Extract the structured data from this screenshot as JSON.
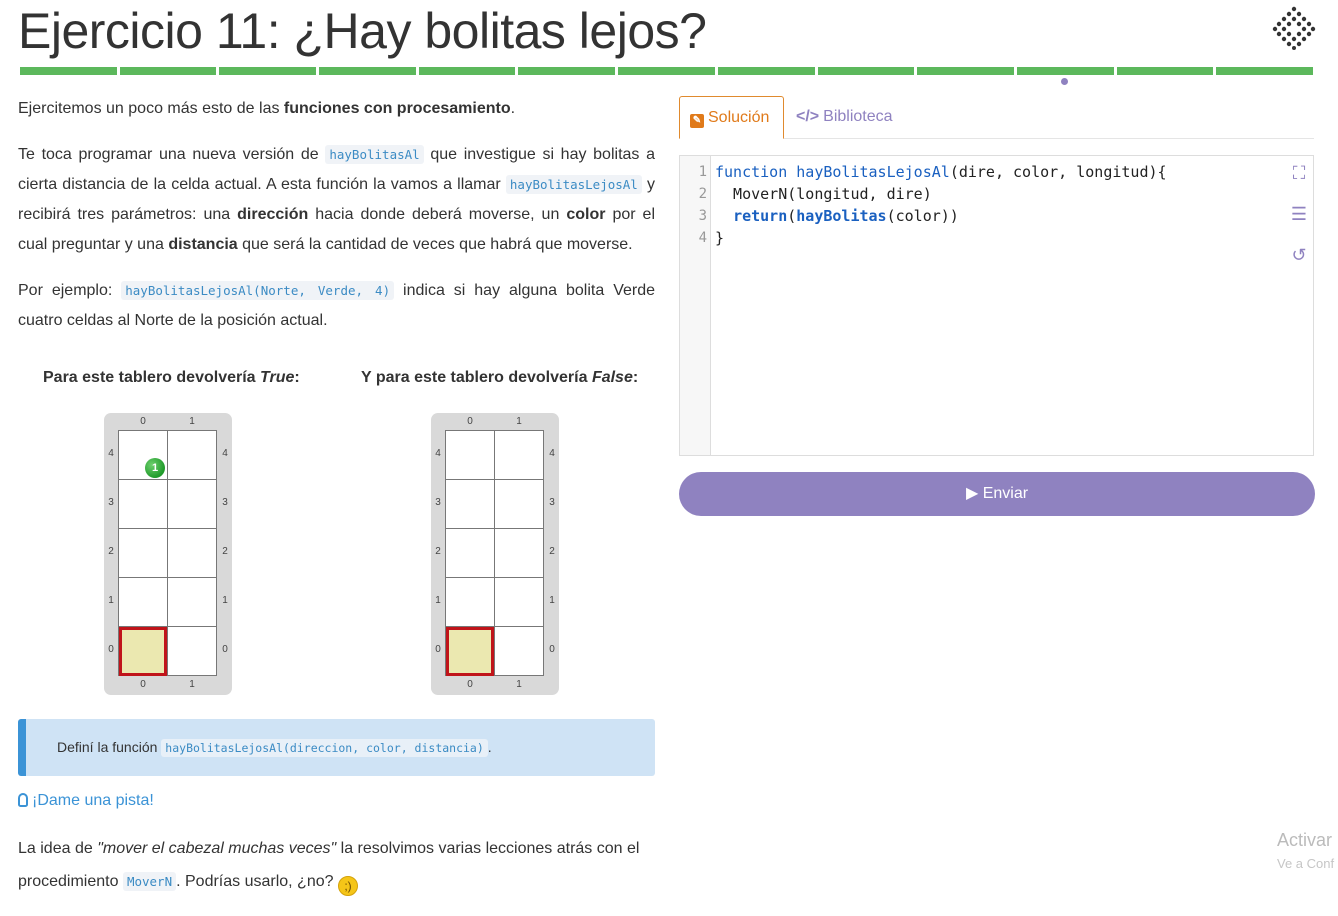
{
  "header": {
    "title": "Ejercicio 11: ¿Hay bolitas lejos?",
    "progress_segments": 13,
    "current_segment_index": 10
  },
  "intro": {
    "p1_a": "Ejercitemos un poco más esto de las ",
    "p1_b": "funciones con procesamiento",
    "p1_c": ".",
    "p2_a": "Te toca programar una nueva versión de ",
    "p2_code1": "hayBolitasAl",
    "p2_b": " que investigue si hay bolitas a cierta distancia de la celda actual. A esta función la vamos a llamar ",
    "p2_code2": "hayBolitasLejosAl",
    "p2_c": " y recibirá tres parámetros: una ",
    "p2_bold1": "dirección",
    "p2_d": " hacia donde deberá moverse, un ",
    "p2_bold2": "color",
    "p2_e": " por el cual preguntar y una ",
    "p2_bold3": "distancia",
    "p2_f": " que será la cantidad de veces que habrá que moverse.",
    "p3_a": "Por ejemplo: ",
    "p3_code": "hayBolitasLejosAl(Norte, Verde, 4)",
    "p3_b": " indica si hay alguna bolita Verde cuatro celdas al Norte de la posición actual."
  },
  "boards": {
    "left_title_a": "Para este tablero devolvería ",
    "left_title_b": "True",
    "left_title_c": ":",
    "right_title_a": "Y para este tablero devolvería ",
    "right_title_b": "False",
    "right_title_c": ":",
    "ball_count": "1",
    "ball_color": "#23a12f",
    "head_color": "#c0141a",
    "cols": [
      "0",
      "1"
    ],
    "rows": [
      "4",
      "3",
      "2",
      "1",
      "0"
    ]
  },
  "note": {
    "text": "Definí la función ",
    "code": "hayBolitasLejosAl(direccion, color, distancia)",
    "end": "."
  },
  "hint": {
    "label": "¡Dame una pista!"
  },
  "idea": {
    "a": "La idea de ",
    "em": "\"mover el cabezal muchas veces\"",
    "b": " la resolvimos varias lecciones atrás con el procedimiento ",
    "code": "MoverN",
    "c": ". Podrías usarlo, ¿no?"
  },
  "tabs": {
    "solution": "Solución",
    "library": "Biblioteca"
  },
  "editor": {
    "line_numbers": [
      "1",
      "2",
      "3",
      "4"
    ],
    "l1_kw": "function",
    "l1_name": "hayBolitasLejosAl",
    "l1_rest": "(dire, color, longitud){",
    "l2": "  MoverN(longitud, dire)",
    "l3_indent": "  ",
    "l3_kw": "return",
    "l3_a": "(",
    "l3_fn": "hayBolitas",
    "l3_b": "(color))",
    "l4": "}"
  },
  "send": {
    "label": "Enviar"
  },
  "watermark": {
    "title": "Activar",
    "sub": "Ve a Conf"
  },
  "colors": {
    "accent": "#8f82c0",
    "progress": "#5cb85c",
    "solution_tab": "#e07a1a",
    "link": "#3b93d6"
  }
}
